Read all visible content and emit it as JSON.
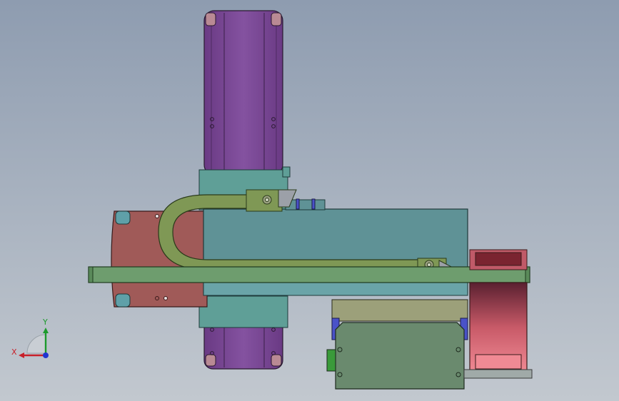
{
  "viewport": {
    "background_top": "#8e9cb0",
    "background_bottom": "#c2c8cf"
  },
  "triad": {
    "x_label": "X",
    "y_label": "Y",
    "x_color": "#c8202a",
    "y_color": "#1c9a2c",
    "z_color": "#2036d0"
  },
  "colors": {
    "motor_purple": "#7b4a94",
    "motor_cap": "#b98a94",
    "teal_block": "#5f9f97",
    "teal_body": "#5f9296",
    "cable_chain": "#7f9855",
    "base_plate": "#6e9d6e",
    "red_housing": "#a05a58",
    "tan_bracket": "#9ca07a",
    "gray_block": "#6a8a6e",
    "pink_motor": "#d76a78",
    "blue_slider": "#4a52c8"
  }
}
